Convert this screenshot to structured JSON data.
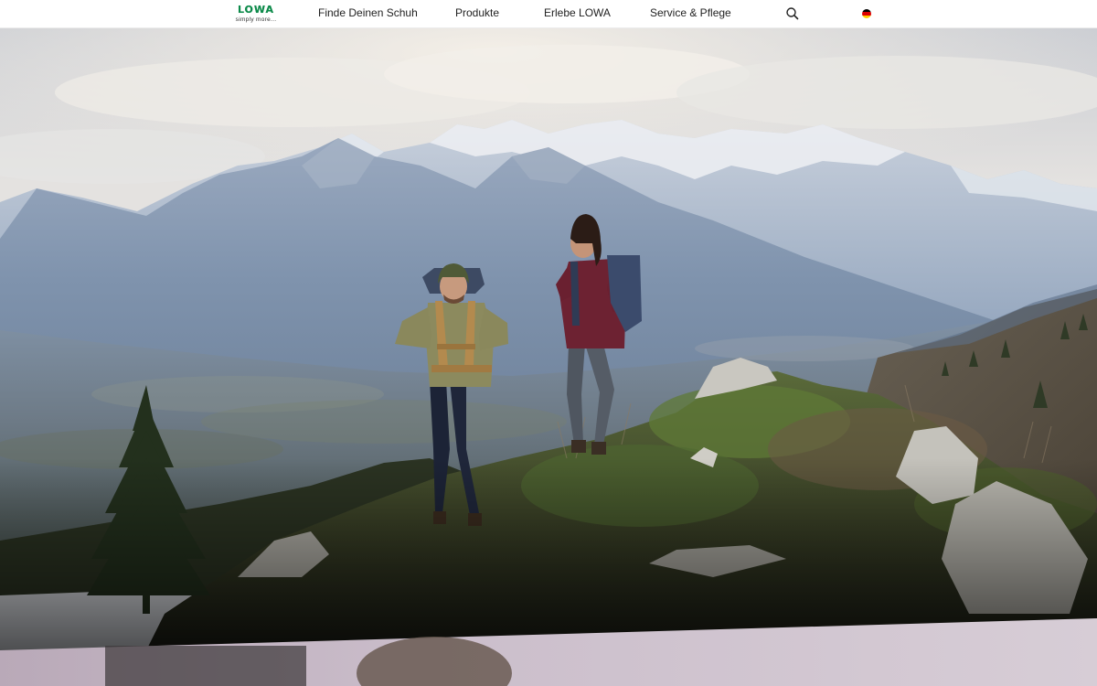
{
  "header": {
    "logo": {
      "wordmark": "LOWA",
      "tagline": "simply more...",
      "color": "#0d8a4a"
    },
    "nav": [
      {
        "label": "Finde Deinen Schuh"
      },
      {
        "label": "Produkte"
      },
      {
        "label": "Erlebe LOWA"
      },
      {
        "label": "Service & Pflege"
      }
    ],
    "search": {
      "icon": "search-icon"
    },
    "language": {
      "icon": "germany-flag-icon",
      "colors": [
        "#000000",
        "#dd0000",
        "#ffce00"
      ]
    }
  },
  "hero": {
    "image": "two-hikers-on-mountain-ridge",
    "next_section_image": "next-section-photo-preview"
  }
}
